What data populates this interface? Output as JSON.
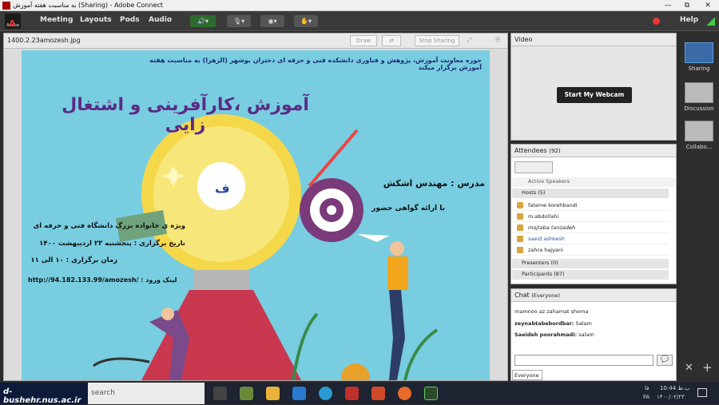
{
  "window": {
    "title": "به مناسبت هفته آموزش (Sharing) - Adobe Connect",
    "controls": [
      "—",
      "⧉",
      "✕"
    ]
  },
  "menubar": {
    "logo": "Adobe",
    "items": [
      "Meeting",
      "Layouts",
      "Pods",
      "Audio"
    ],
    "help": "Help"
  },
  "share": {
    "filename": "1400.2.23amozesh.jpg",
    "draw": "Draw",
    "stop": "Stop Sharing"
  },
  "slide": {
    "header": "حوزه معاونت آموزش، پژوهش و فناوری دانشکده فنی و حرفه ای دختران بوشهر (الزهرا) به مناسبت هفته آموزش برگزار میکند",
    "title": "آموزش ،کارآفرینی و اشتغال زایی",
    "teacher": "مدرس : مهندس اشکش",
    "cert": "با ارائه گواهی حضور",
    "line1": "ویژه ی خانواده بزرگ دانشگاه فنی و حرفه ای",
    "line2": "تاریخ برگزاری : پنجشنبه ۲۳ اردیبهشت ۱۴۰۰",
    "line3": "زمان برگزاری : ۱۰ الی ۱۱",
    "link": "http://94.182.133.99/amozesh/ : لینک ورود"
  },
  "video": {
    "title": "Video",
    "webcam": "Start My Webcam"
  },
  "attendees": {
    "title": "Attendees",
    "count": "(92)",
    "active": "Active Speakers",
    "hosts": "Hosts (5)",
    "names": [
      "fateme korehbandi",
      "m.abdollahi",
      "mojtaba tanzadeh",
      "saeid ashkesh",
      "zahra hajyani"
    ],
    "presenters": "Presenters (0)",
    "participants": "Participants (87)"
  },
  "chat": {
    "title": "Chat",
    "scope": "(Everyone)",
    "lines": [
      {
        "n": "",
        "m": "mamnoo az zahamat shoma"
      },
      {
        "n": "zeynabtabebordbar:",
        "m": "Salam"
      },
      {
        "n": "Saeideh poorahmadi:",
        "m": "salam"
      }
    ],
    "tab": "Everyone"
  },
  "layouts": [
    {
      "label": "Sharing"
    },
    {
      "label": "Discussion"
    },
    {
      "label": "Collabo..."
    }
  ],
  "taskbar": {
    "search": "search",
    "watermark": "d-bushehr.nus.ac.ir",
    "time": "ب.ظ 10:44",
    "date": "۱۴۰۰/۰۲/۲۳",
    "lang": "FA",
    "fa": "فا"
  },
  "colors": {
    "accent": "#e33",
    "slide_bg": "#78cde0"
  }
}
